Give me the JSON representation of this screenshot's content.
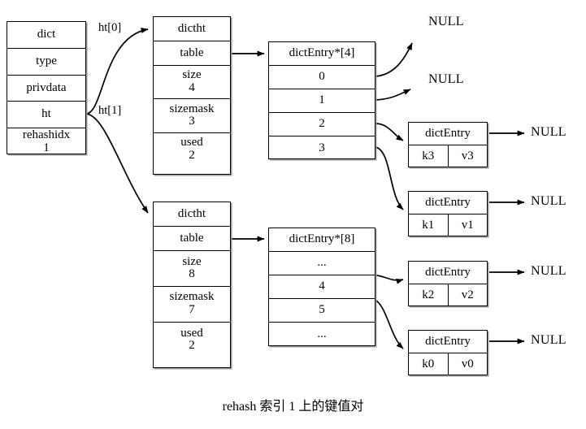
{
  "diagram": {
    "caption": "rehash 索引 1 上的键值对",
    "colors": {
      "stroke": "#000000",
      "background": "#ffffff",
      "shadow": "#9a9a9a"
    },
    "dict": {
      "title": "dict",
      "fields": [
        {
          "label": "dict"
        },
        {
          "label": "type"
        },
        {
          "label": "privdata"
        },
        {
          "label": "ht"
        },
        {
          "label": "rehashidx\n1"
        }
      ]
    },
    "edge_labels": {
      "ht0": "ht[0]",
      "ht1": "ht[1]"
    },
    "hashtables": [
      {
        "title": "dictht",
        "fields": [
          {
            "label": "dictht"
          },
          {
            "label": "table"
          },
          {
            "label": "size\n4"
          },
          {
            "label": "sizemask\n3"
          },
          {
            "label": "used\n2"
          }
        ],
        "array": {
          "header": "dictEntry*[4]",
          "slots": [
            "0",
            "1",
            "2",
            "3"
          ]
        }
      },
      {
        "title": "dictht",
        "fields": [
          {
            "label": "dictht"
          },
          {
            "label": "table"
          },
          {
            "label": "size\n8"
          },
          {
            "label": "sizemask\n7"
          },
          {
            "label": "used\n2"
          }
        ],
        "array": {
          "header": "dictEntry*[8]",
          "slots": [
            "...",
            "4",
            "5",
            "..."
          ]
        }
      }
    ],
    "entries": [
      {
        "title": "dictEntry",
        "key": "k3",
        "value": "v3",
        "next": "NULL"
      },
      {
        "title": "dictEntry",
        "key": "k1",
        "value": "v1",
        "next": "NULL"
      },
      {
        "title": "dictEntry",
        "key": "k2",
        "value": "v2",
        "next": "NULL"
      },
      {
        "title": "dictEntry",
        "key": "k0",
        "value": "v0",
        "next": "NULL"
      }
    ],
    "empty_buckets": [
      {
        "label": "NULL"
      },
      {
        "label": "NULL"
      }
    ]
  }
}
